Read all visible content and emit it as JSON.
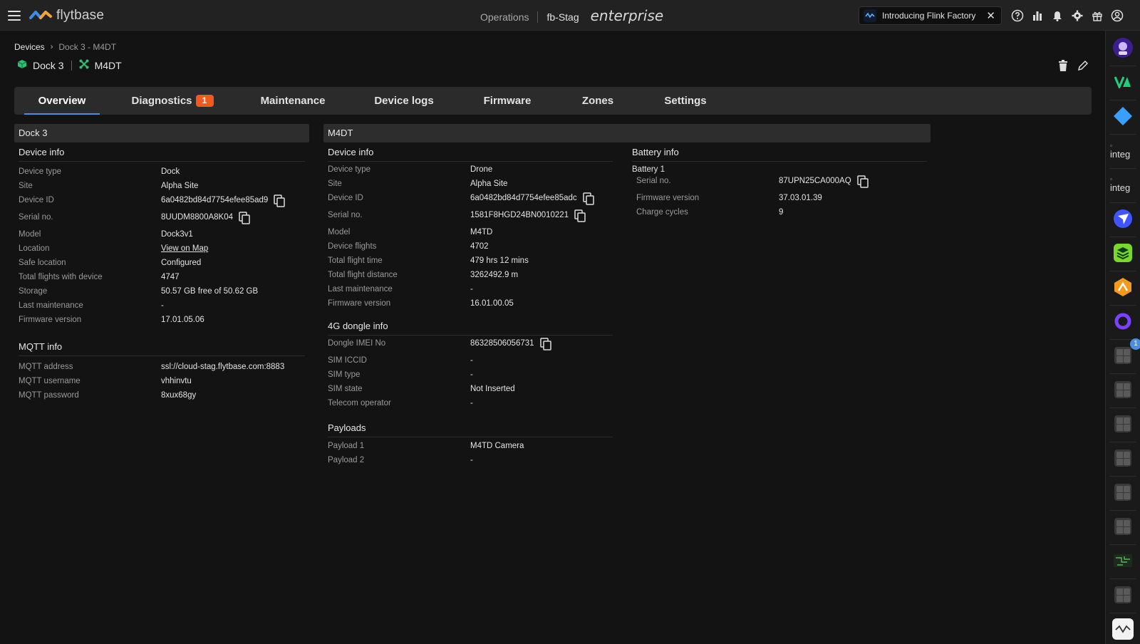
{
  "topbar": {
    "logo_text": "flytbase",
    "operations": "Operations",
    "org": "fb-Stag",
    "edition": "enterprise",
    "banner_text": "Introducing Flink Factory",
    "banner_close": "✕"
  },
  "breadcrumb": {
    "root": "Devices",
    "separator": "›",
    "current": "Dock 3 - M4DT"
  },
  "device_header": {
    "dock": "Dock 3",
    "drone": "M4DT"
  },
  "tabs": [
    {
      "label": "Overview"
    },
    {
      "label": "Diagnostics",
      "badge": "1"
    },
    {
      "label": "Maintenance"
    },
    {
      "label": "Device logs"
    },
    {
      "label": "Firmware"
    },
    {
      "label": "Zones"
    },
    {
      "label": "Settings"
    }
  ],
  "dock_panel": {
    "title": "Dock 3",
    "device_info_title": "Device info",
    "device_info": [
      {
        "label": "Device type",
        "value": "Dock"
      },
      {
        "label": "Site",
        "value": "Alpha Site"
      },
      {
        "label": "Device ID",
        "value": "6a0482bd84d7754efee85ad9"
      },
      {
        "label": "Serial no.",
        "value": "8UUDM8800A8K04"
      },
      {
        "label": "Model",
        "value": "Dock3v1"
      },
      {
        "label": "Location",
        "value": "View on Map"
      },
      {
        "label": "Safe location",
        "value": "Configured"
      },
      {
        "label": "Total flights with device",
        "value": "4747"
      },
      {
        "label": "Storage",
        "value": "50.57 GB free of 50.62 GB"
      },
      {
        "label": "Last maintenance",
        "value": "-"
      },
      {
        "label": "Firmware version",
        "value": "17.01.05.06"
      }
    ],
    "mqtt_title": "MQTT info",
    "mqtt_info": [
      {
        "label": "MQTT address",
        "value": "ssl://cloud-stag.flytbase.com:8883"
      },
      {
        "label": "MQTT username",
        "value": "vhhinvtu"
      },
      {
        "label": "MQTT password",
        "value": "8xux68gy"
      }
    ]
  },
  "drone_panel": {
    "title": "M4DT",
    "device_info_title": "Device info",
    "device_info": [
      {
        "label": "Device type",
        "value": "Drone"
      },
      {
        "label": "Site",
        "value": "Alpha Site"
      },
      {
        "label": "Device ID",
        "value": "6a0482bd84d7754efee85adc"
      },
      {
        "label": "Serial no.",
        "value": "1581F8HGD24BN0010221"
      },
      {
        "label": "Model",
        "value": "M4TD"
      },
      {
        "label": "Device flights",
        "value": "4702"
      },
      {
        "label": "Total flight time",
        "value": "479 hrs 12 mins"
      },
      {
        "label": "Total flight distance",
        "value": "3262492.9 m"
      },
      {
        "label": "Last maintenance",
        "value": "-"
      },
      {
        "label": "Firmware version",
        "value": "16.01.00.05"
      }
    ],
    "dongle_title": "4G dongle info",
    "dongle_info": [
      {
        "label": "Dongle IMEI No",
        "value": "86328506056731"
      },
      {
        "label": "SIM ICCID",
        "value": "-"
      },
      {
        "label": "SIM type",
        "value": "-"
      },
      {
        "label": "SIM state",
        "value": "Not Inserted"
      },
      {
        "label": "Telecom operator",
        "value": "-"
      }
    ],
    "payloads_title": "Payloads",
    "payloads": [
      {
        "label": "Payload 1",
        "value": "M4TD Camera"
      },
      {
        "label": "Payload 2",
        "value": "-"
      }
    ],
    "battery_title": "Battery info",
    "battery_name": "Battery 1",
    "battery_info": [
      {
        "label": "Serial no.",
        "value": "87UPN25CA000AQ"
      },
      {
        "label": "Firmware version",
        "value": "37.03.01.39"
      },
      {
        "label": "Charge cycles",
        "value": "9"
      }
    ]
  },
  "sidebar": {
    "integration_alt": "integ",
    "notification_count": "1"
  },
  "colors": {
    "accent": "#4a8fe0",
    "badge": "#f05a1f",
    "link": "#4d8fe8",
    "dock_icon": "#2fbf71",
    "drone_icon": "#2fbf71"
  }
}
